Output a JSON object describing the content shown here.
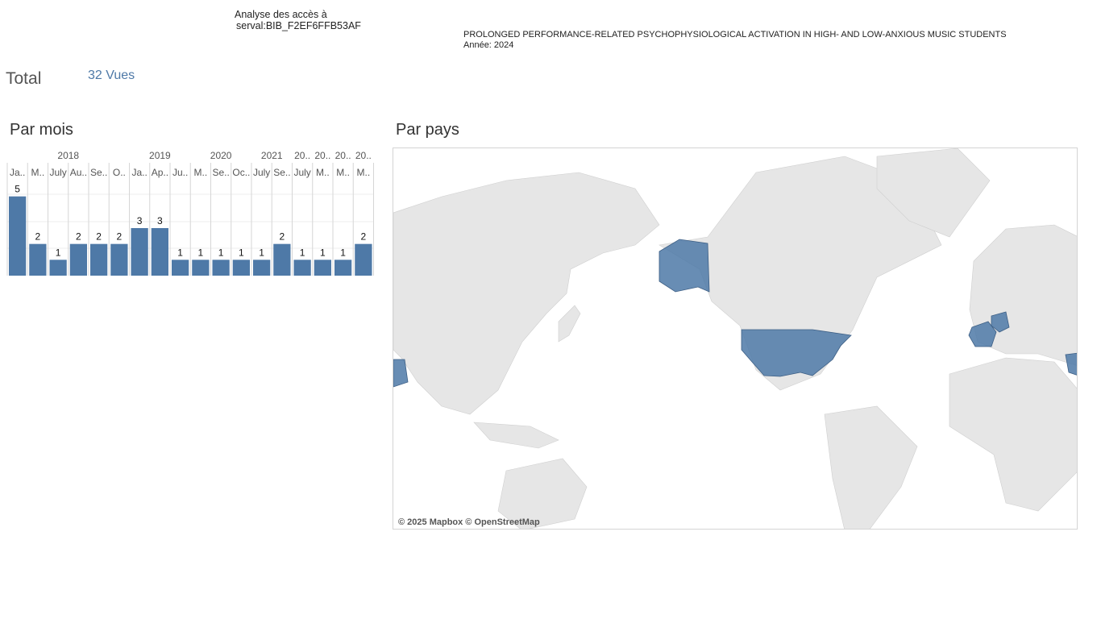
{
  "header": {
    "analyse_line1": "Analyse des accès à",
    "analyse_line2": "serval:BIB_F2EF6FFB53AF",
    "title": "PROLONGED PERFORMANCE-RELATED PSYCHOPHYSIOLOGICAL ACTIVATION IN HIGH- AND LOW-ANXIOUS MUSIC STUDENTS",
    "year_line": "Année: 2024"
  },
  "total": {
    "label": "Total",
    "value": "32 Vues"
  },
  "monthly": {
    "title": "Par mois"
  },
  "country": {
    "title": "Par pays",
    "attribution": "© 2025 Mapbox © OpenStreetMap",
    "highlight_color": "#4e79a7"
  },
  "colors": {
    "bar": "#4e79a7",
    "accent_text": "#4e79a7"
  },
  "chart_data": {
    "type": "bar",
    "year_groups": [
      {
        "label": "2018",
        "count": 6
      },
      {
        "label": "2019",
        "count": 3
      },
      {
        "label": "2020",
        "count": 3
      },
      {
        "label": "2021",
        "count": 2
      },
      {
        "label": "20..",
        "count": 1
      },
      {
        "label": "20..",
        "count": 1
      },
      {
        "label": "20..",
        "count": 1
      },
      {
        "label": "20..",
        "count": 1
      }
    ],
    "categories": [
      "Ja..",
      "M..",
      "July",
      "Au..",
      "Se..",
      "O..",
      "Ja..",
      "Ap..",
      "Ju..",
      "M..",
      "Se..",
      "Oc..",
      "July",
      "Se..",
      "July",
      "M..",
      "M..",
      "M.."
    ],
    "values": [
      5,
      2,
      1,
      2,
      2,
      2,
      3,
      3,
      1,
      1,
      1,
      1,
      1,
      2,
      1,
      1,
      1,
      2
    ],
    "ylim": [
      0,
      6
    ],
    "xlabel": "",
    "ylabel": ""
  }
}
